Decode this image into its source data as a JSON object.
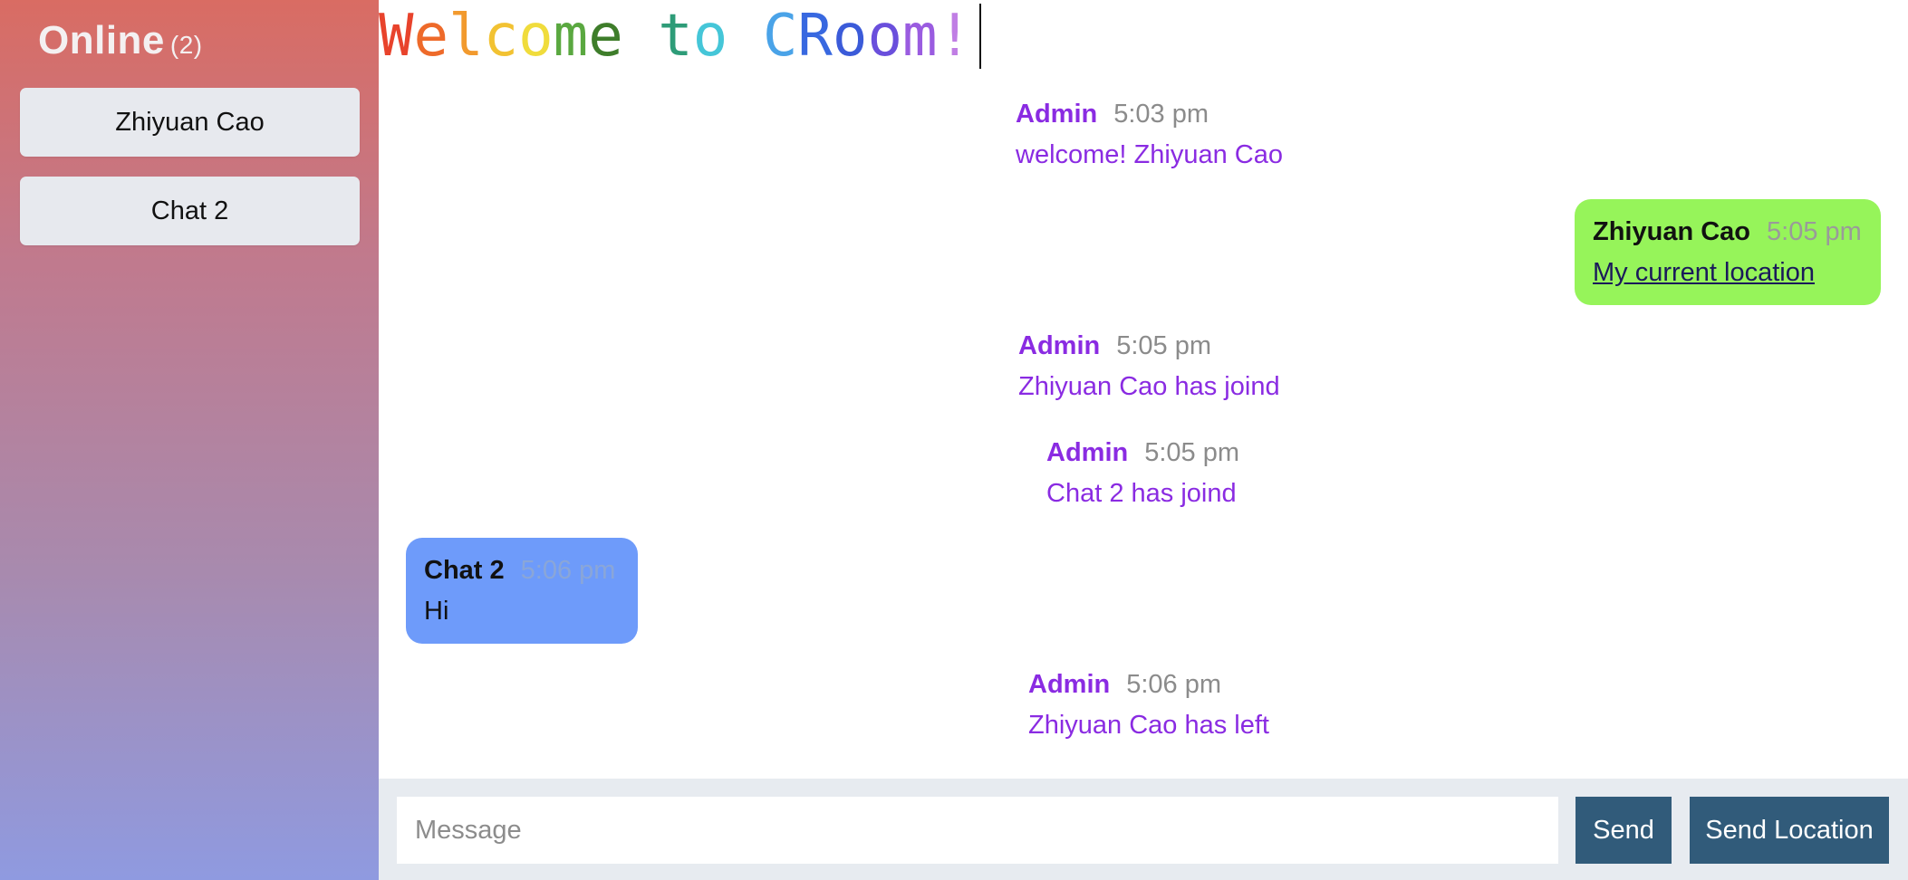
{
  "sidebar": {
    "title": "Online",
    "count": "(2)",
    "users": [
      "Zhiyuan Cao",
      "Chat 2"
    ]
  },
  "header": {
    "welcome": "Welcome to CRoom!",
    "welcome_colors": [
      "#e8432c",
      "#ee6a2a",
      "#f29a2e",
      "#f2c232",
      "#f0dc3c",
      "#5aa840",
      "#3e7d2a",
      "#2e9c78",
      "#45c6d8",
      "#4aa3e8",
      "#3868e0",
      "#3b5bd9",
      "#6a4fdc",
      "#9a5ce0",
      "#c07ee4",
      "#b980e6",
      "#cc6fe4"
    ]
  },
  "messages": [
    {
      "name": "Admin",
      "time": "5:03 pm",
      "text": "welcome! Zhiyuan Cao"
    },
    {
      "name": "Zhiyuan Cao",
      "time": "5:05 pm",
      "text": "My current location"
    },
    {
      "name": "Admin",
      "time": "5:05 pm",
      "text": "Zhiyuan Cao has joind"
    },
    {
      "name": "Admin",
      "time": "5:05 pm",
      "text": "Chat 2 has joind"
    },
    {
      "name": "Chat 2",
      "time": "5:06 pm",
      "text": "Hi"
    },
    {
      "name": "Admin",
      "time": "5:06 pm",
      "text": "Zhiyuan Cao has left"
    }
  ],
  "composer": {
    "placeholder": "Message",
    "send_label": "Send",
    "location_label": "Send Location"
  },
  "colors": {
    "admin": "#8a2be2",
    "self_bubble": "#96f45a",
    "other_bubble": "#6e9bfa",
    "button": "#315b7a"
  }
}
